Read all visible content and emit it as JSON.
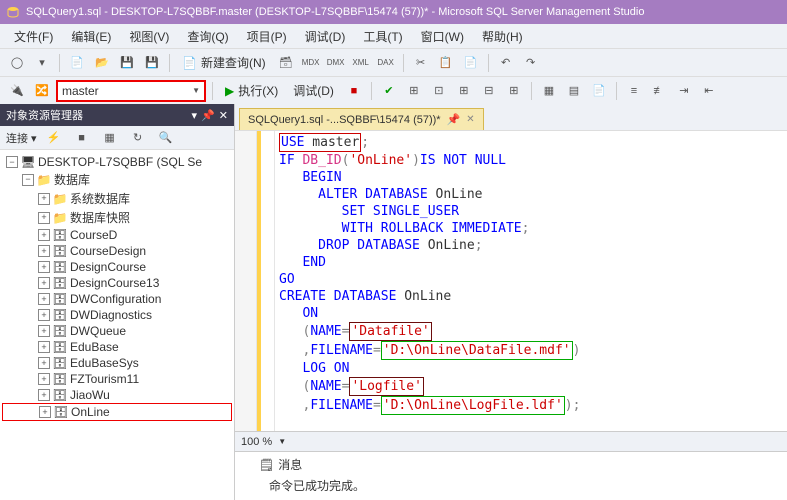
{
  "titlebar": {
    "title": "SQLQuery1.sql - DESKTOP-L7SQBBF.master (DESKTOP-L7SQBBF\\15474 (57))* - Microsoft SQL Server Management Studio"
  },
  "menu": {
    "file": "文件(F)",
    "edit": "编辑(E)",
    "view": "视图(V)",
    "query": "查询(Q)",
    "project": "项目(P)",
    "debug": "调试(D)",
    "tools": "工具(T)",
    "window": "窗口(W)",
    "help": "帮助(H)"
  },
  "toolbar1": {
    "new_query": "新建查询(N)"
  },
  "toolbar2": {
    "db_selected": "master",
    "execute": "执行(X)",
    "debug": "调试(D)"
  },
  "explorer": {
    "title": "对象资源管理器",
    "connect": "连接 ▾",
    "root": "DESKTOP-L7SQBBF (SQL Se",
    "databases": "数据库",
    "items": [
      "系统数据库",
      "数据库快照",
      "CourseD",
      "CourseDesign",
      "DesignCourse",
      "DesignCourse13",
      "DWConfiguration",
      "DWDiagnostics",
      "DWQueue",
      "EduBase",
      "EduBaseSys",
      "FZTourism11",
      "JiaoWu",
      "OnLine"
    ]
  },
  "tabs": {
    "file": "SQLQuery1.sql -...SQBBF\\15474 (57))*"
  },
  "code": {
    "l1a": "USE",
    "l1b": " master",
    "l1c": ";",
    "l2a": "IF",
    "l2b": " DB_ID",
    "l2c": "(",
    "l2d": "'OnLine'",
    "l2e": ")",
    "l2f": "IS NOT NULL",
    "l3": "BEGIN",
    "l4a": "ALTER DATABASE",
    "l4b": " OnLine",
    "l5": "SET SINGLE_USER",
    "l6a": "WITH ROLLBACK IMMEDIATE",
    "l6b": ";",
    "l7a": "DROP DATABASE",
    "l7b": " OnLine",
    "l7c": ";",
    "l8": "END",
    "l9": "GO",
    "l10a": "CREATE DATABASE",
    "l10b": " OnLine",
    "l11": "ON",
    "l12a": "(",
    "l12b": "NAME",
    "l12c": "=",
    "l12d": "'Datafile'",
    "l13a": ",",
    "l13b": "FILENAME",
    "l13c": "=",
    "l13d": "'D:\\OnLine\\DataFile.mdf'",
    "l13e": ")",
    "l14": "LOG ON",
    "l15a": "(",
    "l15b": "NAME",
    "l15c": "=",
    "l15d": "'Logfile'",
    "l16a": ",",
    "l16b": "FILENAME",
    "l16c": "=",
    "l16d": "'D:\\OnLine\\LogFile.ldf'",
    "l16e": ")",
    "l16f": ";"
  },
  "zoom": {
    "level": "100 %"
  },
  "messages": {
    "tab": "消息",
    "body": "命令已成功完成。"
  }
}
